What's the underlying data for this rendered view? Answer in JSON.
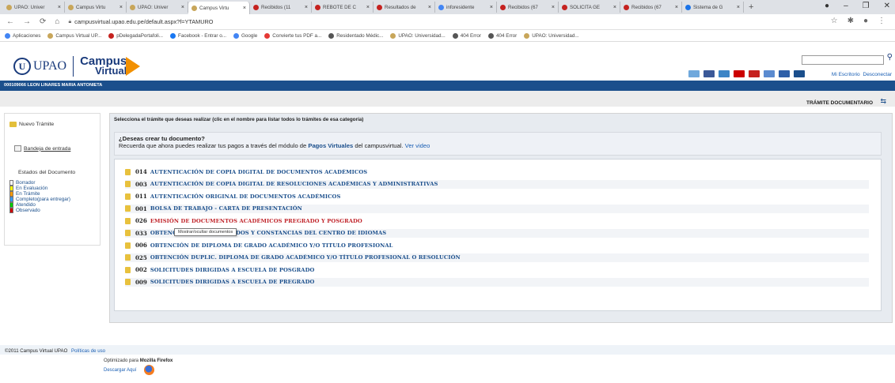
{
  "browser": {
    "tabs": [
      {
        "title": "UPAO: Univer",
        "color": "#c8a65a",
        "active": false
      },
      {
        "title": "Campus Virtu",
        "color": "#c8a65a",
        "active": false
      },
      {
        "title": "UPAO: Univer",
        "color": "#c8a65a",
        "active": false
      },
      {
        "title": "Campus Virtu",
        "color": "#c8a65a",
        "active": true
      },
      {
        "title": "Recibidos (11",
        "color": "#c5221f",
        "active": false
      },
      {
        "title": "REBOTE DE C",
        "color": "#c5221f",
        "active": false
      },
      {
        "title": "Resultados de",
        "color": "#c5221f",
        "active": false
      },
      {
        "title": "inforesidente",
        "color": "#4285f4",
        "active": false
      },
      {
        "title": "Recibidos (67",
        "color": "#c5221f",
        "active": false
      },
      {
        "title": "SOLICITA GE",
        "color": "#c5221f",
        "active": false
      },
      {
        "title": "Recibidos (67",
        "color": "#c5221f",
        "active": false
      },
      {
        "title": "Sistema de G",
        "color": "#1a73e8",
        "active": false
      }
    ],
    "url": "campusvirtual.upao.edu.pe/default.aspx?f=YTAMURO",
    "bookmarks": [
      {
        "label": "Aplicaciones",
        "color": "#4285f4"
      },
      {
        "label": "Campus Virtual UP...",
        "color": "#c8a65a"
      },
      {
        "label": "pDelegadaPortafoli...",
        "color": "#c5221f"
      },
      {
        "label": "Facebook - Entrar o...",
        "color": "#1877f2"
      },
      {
        "label": "Google",
        "color": "#4285f4"
      },
      {
        "label": "Convierte tus PDF a...",
        "color": "#e53935"
      },
      {
        "label": "Residentado Médic...",
        "color": "#555555"
      },
      {
        "label": "UPAO: Universidad...",
        "color": "#c8a65a"
      },
      {
        "label": "404 Error",
        "color": "#555555"
      },
      {
        "label": "404 Error",
        "color": "#555555"
      },
      {
        "label": "UPAO: Universidad...",
        "color": "#c8a65a"
      }
    ]
  },
  "site": {
    "logo_upao": "UPAO",
    "logo_campus": "Campus",
    "logo_virtual": "Virtual",
    "links": {
      "mi_escritorio": "Mi Escritorio",
      "desconectar": "Desconectar"
    },
    "user": "000109066 LEON LINARES MARIA ANTONIETA",
    "section_title": "TRÁMITE DOCUMENTARIO"
  },
  "sidebar": {
    "nuevo_tramite": "Nuevo Trámite",
    "bandeja": "Bandeja de entrada",
    "estados_title": "Estados del Documento",
    "estados": [
      {
        "label": "Borrador",
        "color": "#ffffff"
      },
      {
        "label": "En Evaluación",
        "color": "#ffff00"
      },
      {
        "label": "En Trámite",
        "color": "#ff9900"
      },
      {
        "label": "Completo(para entregar)",
        "color": "#3399ff"
      },
      {
        "label": "Atendido",
        "color": "#00cc00"
      },
      {
        "label": "Observado",
        "color": "#cc0000"
      }
    ]
  },
  "main": {
    "instruction": "Selecciona el trámite que deseas realizar (clic en el nombre para listar todos lo trámites de esa categoría)",
    "promo_title": "¿Deseas crear tu documento?",
    "promo_text_pre": "Recuerda que ahora puedes realizar tus pagos a través del módulo de",
    "promo_link": "Pagos Virtuales",
    "promo_text_post": "del campusvirtual.",
    "promo_video": "Ver video",
    "tooltip": "Mostrar/ocultar documentos",
    "categories": [
      {
        "code": "014",
        "name": "AUTENTICACIÓN DE COPIA DIGITAL DE DOCUMENTOS ACADÉMICOS"
      },
      {
        "code": "003",
        "name": "AUTENTICACIÓN DE COPIA DIGITAL DE RESOLUCIONES ACADÉMICAS Y ADMINISTRATIVAS"
      },
      {
        "code": "011",
        "name": "AUTENTICACIÓN ORIGINAL DE DOCUMENTOS ACADÉMICOS"
      },
      {
        "code": "001",
        "name": "BOLSA DE TRABAJO - CARTA DE PRESENTACIÓN"
      },
      {
        "code": "026",
        "name": "EMISIÓN DE DOCUMENTOS ACADÉMICOS PREGRADO Y POSGRADO"
      },
      {
        "code": "033",
        "name": "OBTENCIÓN DE CERTIFICADOS Y CONSTANCIAS DEL CENTRO DE IDIOMAS"
      },
      {
        "code": "006",
        "name": "OBTENCIÓN DE DIPLOMA DE GRADO ACADÉMICO Y/O TITULO PROFESIONAL"
      },
      {
        "code": "025",
        "name": "OBTENCIÓN DUPLIC. DIPLOMA DE GRADO ACADÉMICO Y/O TÍTULO PROFESIONAL O RESOLUCIÓN"
      },
      {
        "code": "002",
        "name": "SOLICITUDES DIRIGIDAS A ESCUELA DE POSGRADO"
      },
      {
        "code": "009",
        "name": "SOLICITUDES DIRIGIDAS A ESCUELA DE PREGRADO"
      }
    ]
  },
  "footer": {
    "copyright": "©2011 Campus Virtual UPAO",
    "politicas": "Políticas de uso",
    "optimizado_pre": "Optimizado para",
    "optimizado_browser": "Mozilla Firefox",
    "descargar": "Descargar Aquí"
  }
}
